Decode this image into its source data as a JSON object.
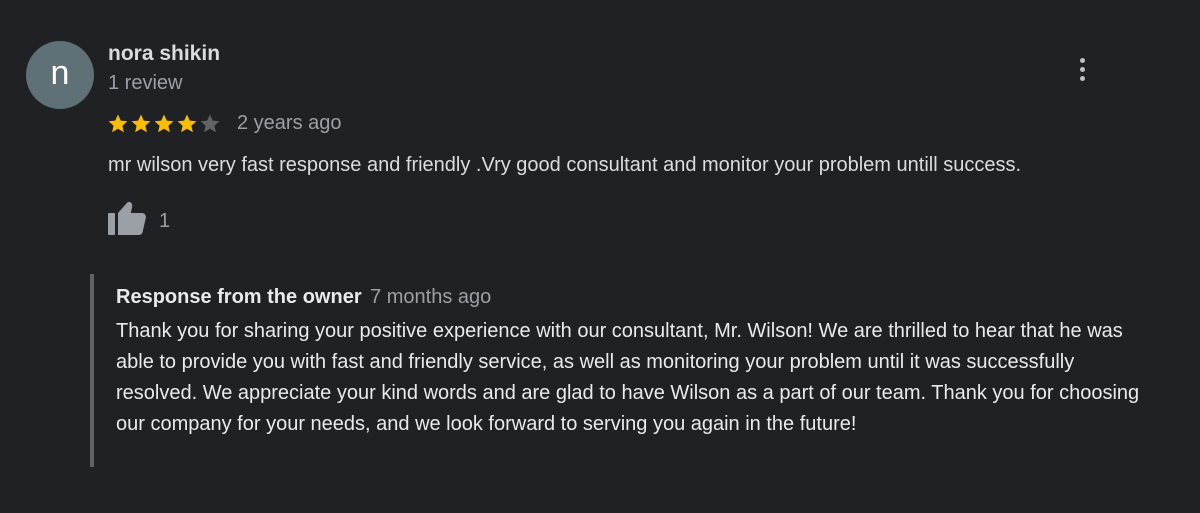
{
  "review": {
    "avatar_letter": "n",
    "reviewer_name": "nora shikin",
    "review_count": "1 review",
    "rating": 4,
    "rating_max": 5,
    "time_ago": "2 years ago",
    "text": "mr wilson very fast response and friendly .Vry good consultant and monitor your problem untill success.",
    "like_count": "1",
    "more_icon": "more-vertical-icon",
    "like_icon": "thumbs-up-icon"
  },
  "owner_response": {
    "title": "Response from the owner",
    "time_ago": "7 months ago",
    "text": "Thank you for sharing your positive experience with our consultant, Mr. Wilson! We are thrilled to hear that he was able to provide you with fast and friendly service, as well as monitoring your problem until it was successfully resolved. We appreciate your kind words and are glad to have Wilson as a part of our team. Thank you for choosing our company for your needs, and we look forward to serving you again in the future!"
  },
  "colors": {
    "background": "#202124",
    "star_filled": "#fbbc04",
    "star_empty": "#5f6368",
    "avatar_bg": "#5f7076"
  }
}
